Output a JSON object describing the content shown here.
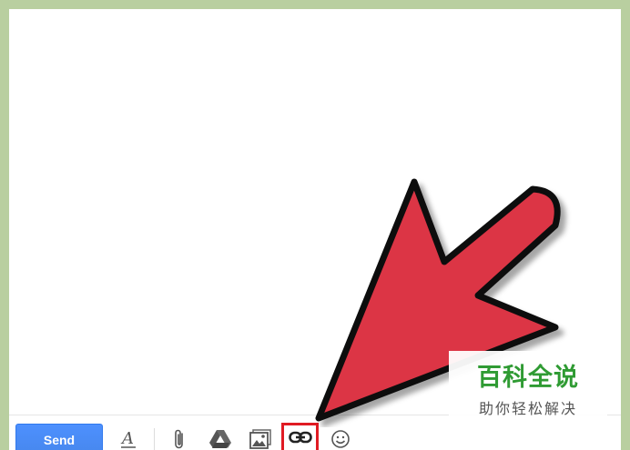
{
  "compose": {
    "send_label": "Send"
  },
  "toolbar": {
    "format_icon": "text-format-icon",
    "attach_icon": "paperclip-icon",
    "drive_icon": "drive-icon",
    "photo_icon": "photo-icon",
    "link_icon": "link-icon",
    "emoji_icon": "emoji-icon"
  },
  "annotation": {
    "arrow_color": "#dc3545",
    "highlight_color": "#e01b23"
  },
  "watermark": {
    "title": "百科全说",
    "subtitle": "助你轻松解决"
  },
  "colors": {
    "frame": "#b9cfa0",
    "send_button": "#4787ed"
  }
}
